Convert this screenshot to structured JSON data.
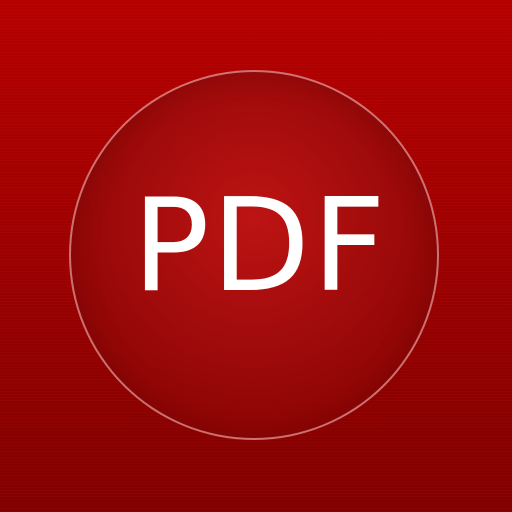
{
  "app_icon": {
    "label": "PDF",
    "colors": {
      "background_top": "#b60000",
      "background_bottom": "#820000",
      "circle_fill": "#9a0a0a",
      "circle_border": "#e7a4a4",
      "text": "#ffffff"
    }
  }
}
